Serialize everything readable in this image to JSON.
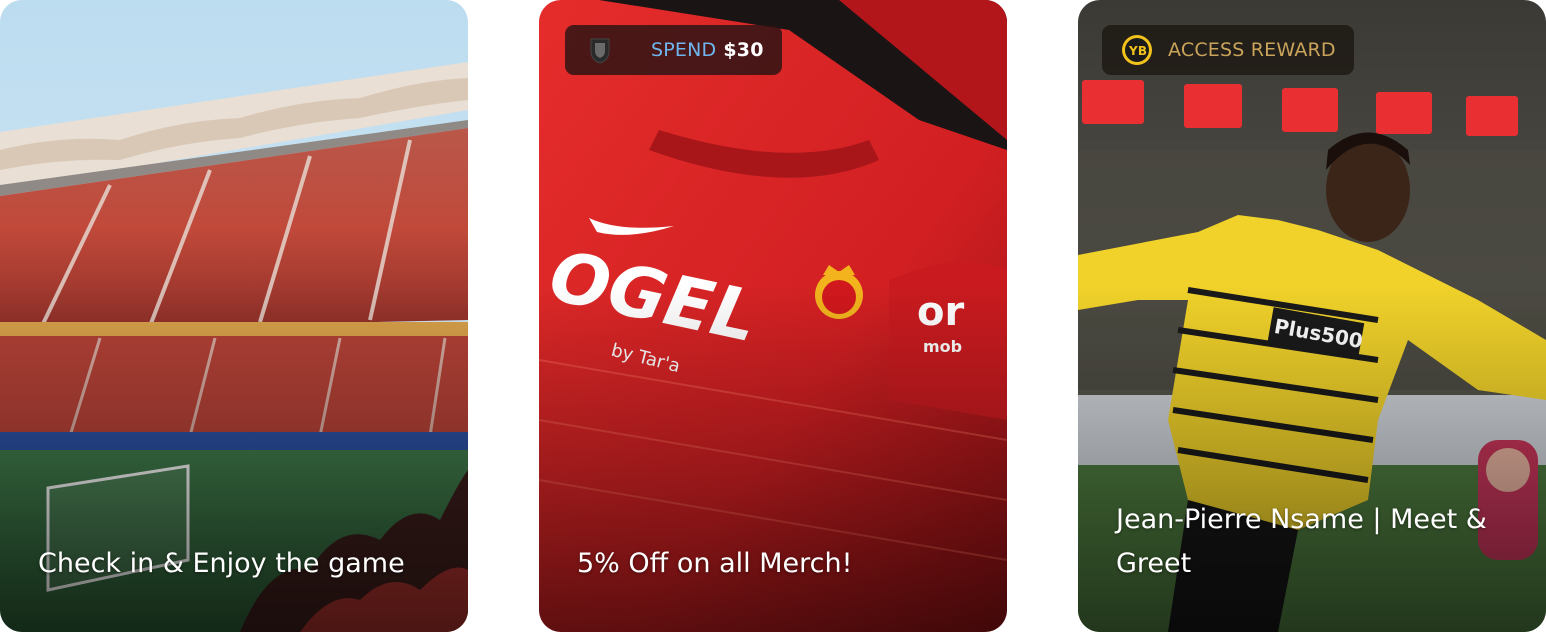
{
  "cards": [
    {
      "title": "Check in & Enjoy the game",
      "scene": "stadium-image"
    },
    {
      "title": "5% Off on all Merch!",
      "scene": "red-jersey-image",
      "badge": {
        "icon": "club-crest-icon",
        "label": "SPEND",
        "amount": "$30",
        "label_color": "#6fb6ef"
      }
    },
    {
      "title": "Jean-Pierre Nsame | Meet & Greet",
      "scene": "player-celebration-image",
      "badge": {
        "icon": "yb-crest-icon",
        "label": "ACCESS REWARD",
        "label_color": "#c9a45a"
      }
    }
  ]
}
